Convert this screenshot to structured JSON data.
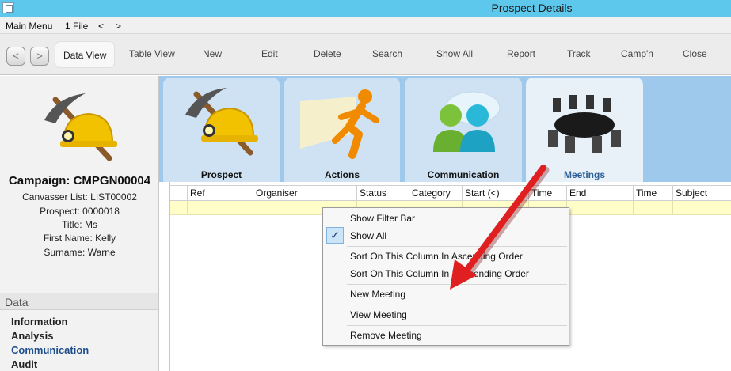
{
  "window": {
    "title": "Prospect Details"
  },
  "menu": {
    "main": "Main Menu",
    "file": "1 File",
    "prev": "<",
    "next": ">"
  },
  "toolbar": {
    "back": "<",
    "forward": ">",
    "buttons": [
      "Data View",
      "Table View",
      "New",
      "Edit",
      "Delete",
      "Search",
      "Show All",
      "Report",
      "Track",
      "Camp'n",
      "Close"
    ]
  },
  "prospect": {
    "campaign": "Campaign: CMPGN00004",
    "canvasser": "Canvasser List: LIST00002",
    "prospect": "Prospect: 0000018",
    "title": "Title: Ms",
    "first_name": "First Name: Kelly",
    "surname": "Surname: Warne"
  },
  "sidebar": {
    "header": "Data",
    "items": [
      "Information",
      "Analysis",
      "Communication",
      "Audit"
    ],
    "selected": "Communication"
  },
  "tabs": [
    "Prospect",
    "Actions",
    "Communication",
    "Meetings"
  ],
  "active_tab": "Meetings",
  "grid": {
    "columns": [
      "Ref",
      "Organiser",
      "Status",
      "Category",
      "Start (<)",
      "Time",
      "End",
      "Time",
      "Subject"
    ]
  },
  "context_menu": {
    "items": [
      "Show Filter Bar",
      "Show All",
      "Sort On This Column In Ascending Order",
      "Sort On This Column In Descending Order",
      "New Meeting",
      "View Meeting",
      "Remove Meeting"
    ],
    "checked": "Show All",
    "check_glyph": "✓"
  },
  "colors": {
    "titlebar": "#5ec8ec",
    "tab_strip": "#9ec8ec",
    "filter_row": "#fffec8",
    "arrow": "#e02020",
    "link_selected": "#1f4e8c"
  }
}
